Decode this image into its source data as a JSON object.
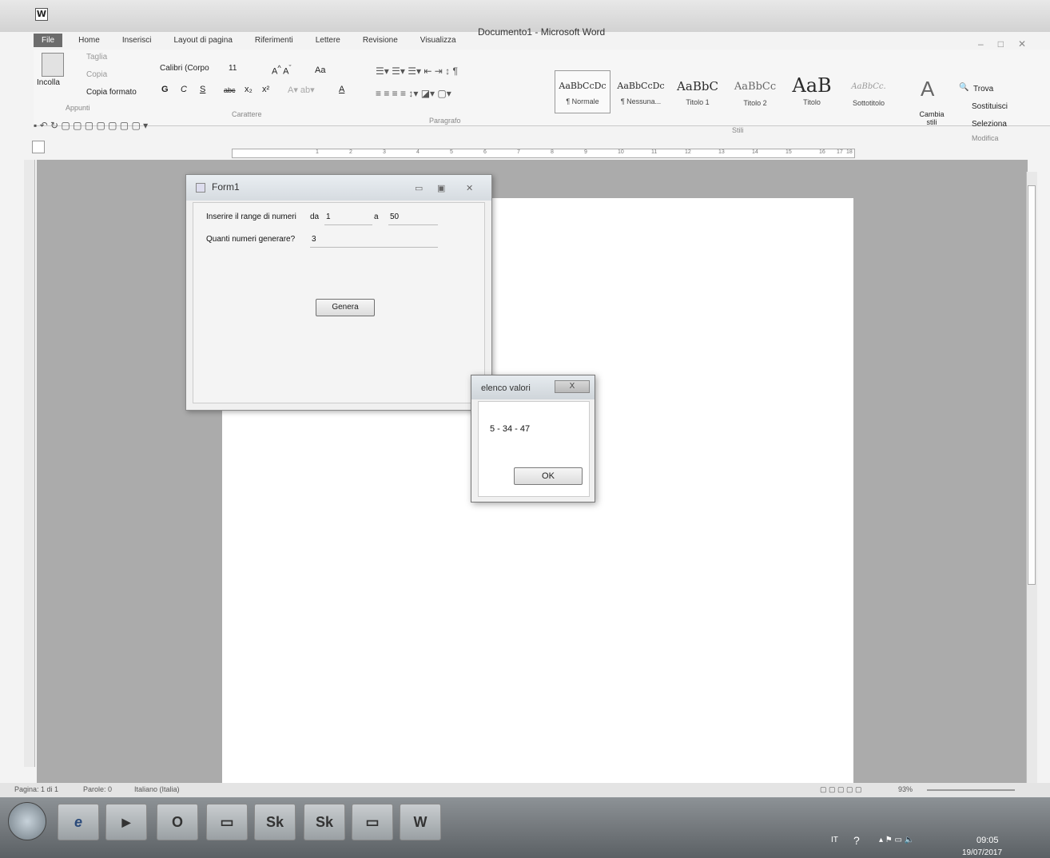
{
  "window": {
    "app_icon": "W",
    "title": "Documento1 - Microsoft Word",
    "controls": [
      "minimize-icon",
      "maximize-icon",
      "close-icon"
    ]
  },
  "tabs": [
    "File",
    "Home",
    "Inserisci",
    "Layout di pagina",
    "Riferimenti",
    "Lettere",
    "Revisione",
    "Visualizza"
  ],
  "ribbon": {
    "clipboard": {
      "paste": "Incolla",
      "cut": "Taglia",
      "copy": "Copia",
      "format_painter": "Copia formato",
      "label": "Appunti"
    },
    "font": {
      "name": "Calibri (Corpo",
      "size": "11",
      "change_case": "Aa",
      "bold": "G",
      "italic": "C",
      "underline": "S",
      "strike": "abc",
      "subscript": "x₂",
      "superscript": "x²",
      "font_color": "A",
      "label": "Carattere"
    },
    "paragraph": {
      "label": "Paragrafo"
    },
    "styles": {
      "items": [
        {
          "preview": "AaBbCcDc",
          "name": "¶ Normale"
        },
        {
          "preview": "AaBbCcDc",
          "name": "¶ Nessuna..."
        },
        {
          "preview": "AaBbC",
          "name": "Titolo 1"
        },
        {
          "preview": "AaBbCc",
          "name": "Titolo 2"
        },
        {
          "preview": "AaB",
          "name": "Titolo"
        },
        {
          "preview": "AaBbCc.",
          "name": "Sottotitolo"
        }
      ],
      "change_styles": "Cambia stili",
      "label": "Stili"
    },
    "editing": {
      "find": "Trova",
      "replace": "Sostituisci",
      "select": "Seleziona",
      "label": "Modifica"
    }
  },
  "ruler": {
    "numbers": [
      "1",
      "2",
      "3",
      "4",
      "5",
      "6",
      "7",
      "8",
      "9",
      "10",
      "11",
      "12",
      "13",
      "14",
      "15",
      "16",
      "17",
      "18"
    ]
  },
  "form1": {
    "title": "Form1",
    "range_label": "Inserire il range di numeri",
    "da_label": "da",
    "da_value": "1",
    "a_label": "a",
    "a_value": "50",
    "count_label": "Quanti numeri generare?",
    "count_value": "3",
    "button": "Genera"
  },
  "msgbox": {
    "title": "elenco valori",
    "close": "X",
    "text": "5 - 34 - 47",
    "ok": "OK"
  },
  "statusbar": {
    "page": "Pagina: 1 di 1",
    "words": "Parole: 0",
    "language": "Italiano (Italia)",
    "zoom": "93%"
  },
  "taskbar": {
    "items": [
      "e",
      "▶",
      "O",
      "▭",
      "Sk",
      "Sk",
      "▭",
      "W"
    ],
    "lang": "IT",
    "time": "09:05",
    "date": "19/07/2017"
  }
}
